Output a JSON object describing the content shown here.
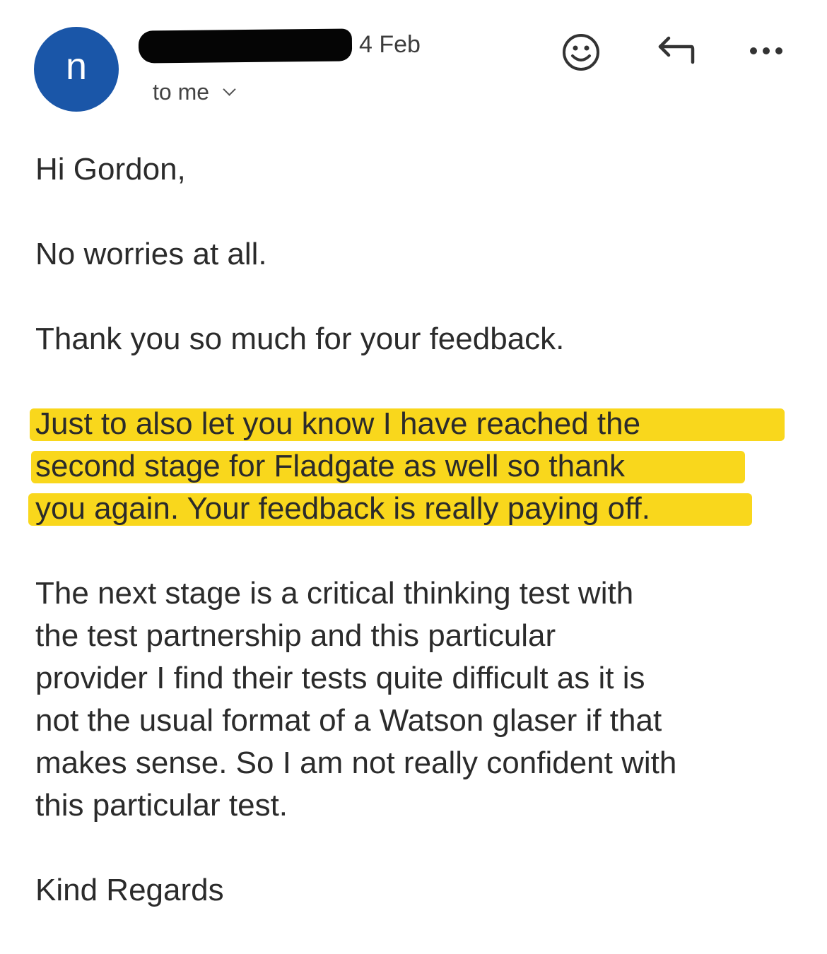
{
  "header": {
    "avatar_letter": "n",
    "date": "4 Feb",
    "recipient": "to me",
    "icons": {
      "emoji": "smiley-icon",
      "reply": "reply-icon",
      "more": "more-dots-icon",
      "expand": "chevron-down-icon"
    }
  },
  "email": {
    "greeting": "Hi Gordon,",
    "p1": "No worries at all.",
    "p2": "Thank you so much for your feedback.",
    "p3_lines": [
      "Just to also let you know I have reached the",
      "second stage for Fladgate as well so thank",
      "you again. Your feedback is really paying off."
    ],
    "p4_lines": [
      "The next stage is a critical thinking test with",
      "the test partnership and this particular",
      "provider I find their tests quite difficult as it is",
      "not the usual format of a Watson glaser if that",
      "makes sense. So I am not really confident with",
      "this particular test."
    ],
    "signoff": "Kind Regards"
  },
  "colors": {
    "avatar": "#1a56a8",
    "highlight": "#f9d71c",
    "redaction": "#050505"
  }
}
